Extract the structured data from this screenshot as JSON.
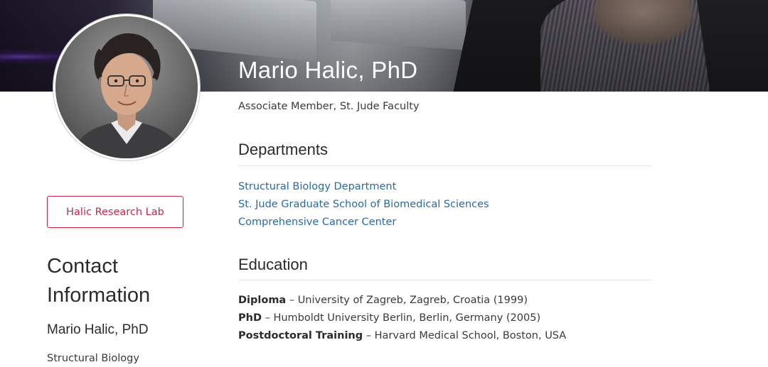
{
  "profile": {
    "name": "Mario Halic, PhD",
    "title": "Associate Member, St. Jude Faculty",
    "lab_button_label": "Halic Research Lab"
  },
  "departments": {
    "heading": "Departments",
    "items": [
      {
        "label": "Structural Biology Department"
      },
      {
        "label": "St. Jude Graduate School of Biomedical Sciences"
      },
      {
        "label": "Comprehensive Cancer Center"
      }
    ]
  },
  "education": {
    "heading": "Education",
    "separator": "–",
    "items": [
      {
        "degree": "Diploma",
        "detail": "University of Zagreb, Zagreb, Croatia (1999)"
      },
      {
        "degree": "PhD",
        "detail": "Humboldt University Berlin, Berlin, Germany (2005)"
      },
      {
        "degree": "Postdoctoral Training",
        "detail": "Harvard Medical School, Boston, USA"
      }
    ]
  },
  "contact": {
    "heading": "Contact Information",
    "name": "Mario Halic, PhD",
    "department": "Structural Biology"
  },
  "colors": {
    "link": "#2a69a8",
    "accent": "#c8264a",
    "text": "#2b2b2b"
  }
}
